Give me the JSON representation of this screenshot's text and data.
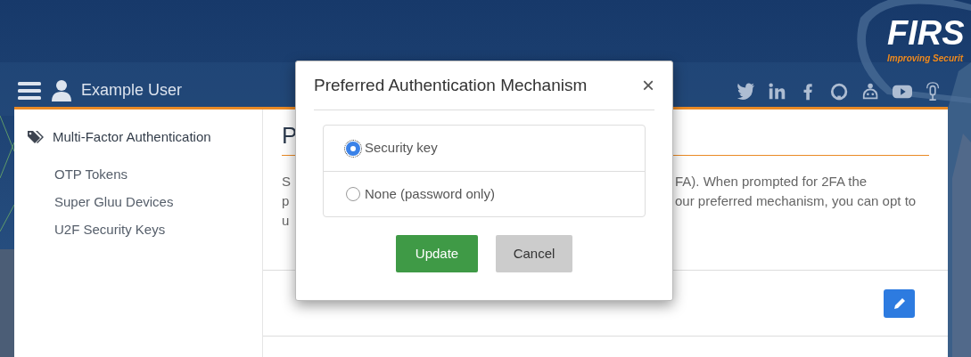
{
  "header": {
    "user_name": "Example User",
    "logo": {
      "name": "FIRS",
      "tagline": "Improving Securit"
    }
  },
  "sidebar": {
    "section": "Multi-Factor Authentication",
    "items": [
      {
        "label": "OTP Tokens"
      },
      {
        "label": "Super Gluu Devices"
      },
      {
        "label": "U2F Security Keys"
      }
    ]
  },
  "content": {
    "heading": "P",
    "description_left": [
      "S",
      "p",
      "u"
    ],
    "description_right": [
      "FA). When prompted for 2FA the",
      "our preferred mechanism, you can opt to"
    ]
  },
  "dialog": {
    "title": "Preferred Authentication Mechanism",
    "close": "×",
    "options": [
      {
        "label": "Security key",
        "selected": true
      },
      {
        "label": "None (password only)",
        "selected": false
      }
    ],
    "buttons": [
      {
        "label": "Update",
        "kind": "primary"
      },
      {
        "label": "Cancel",
        "kind": "secondary"
      }
    ]
  }
}
